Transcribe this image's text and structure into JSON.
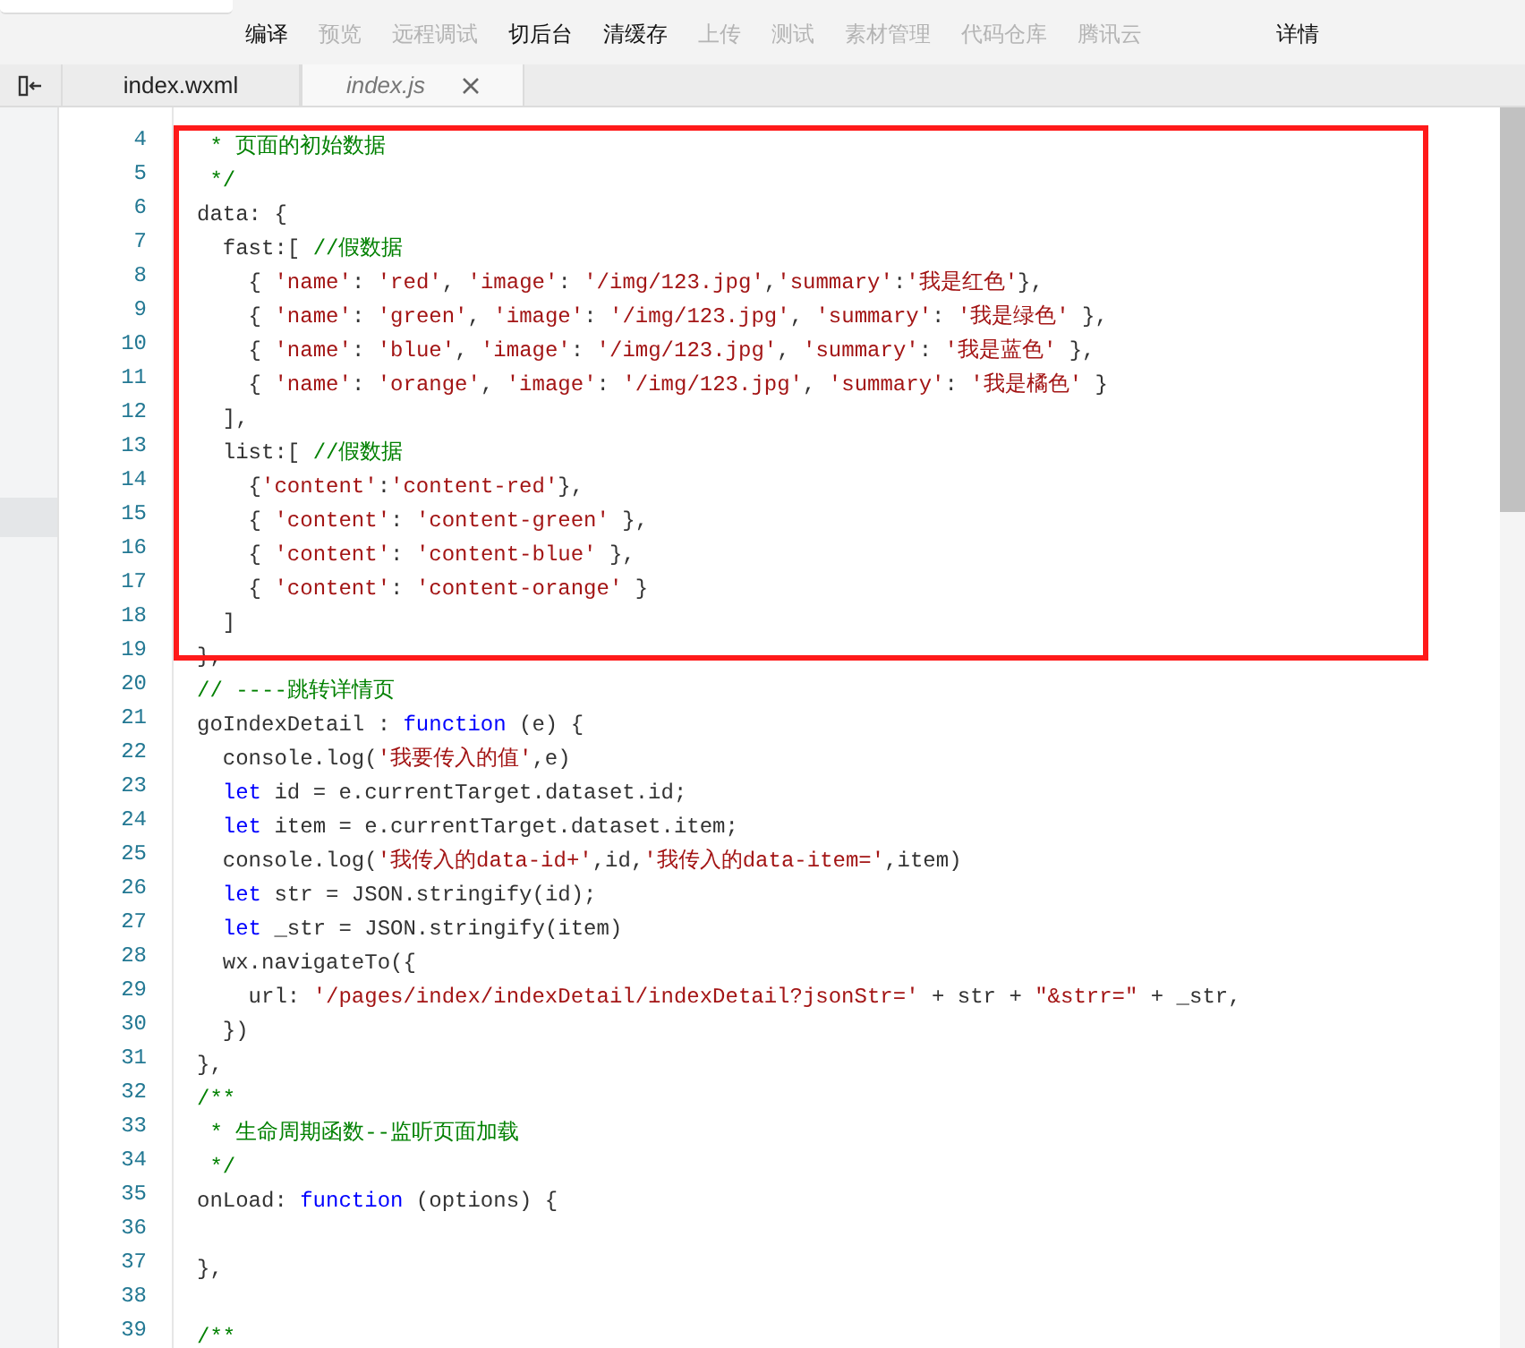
{
  "toolbar": {
    "buttons": [
      {
        "label": "编译",
        "disabled": false
      },
      {
        "label": "预览",
        "disabled": true
      },
      {
        "label": "远程调试",
        "disabled": true
      },
      {
        "label": "切后台",
        "disabled": false
      },
      {
        "label": "清缓存",
        "disabled": false
      },
      {
        "label": "上传",
        "disabled": true
      },
      {
        "label": "测试",
        "disabled": true
      },
      {
        "label": "素材管理",
        "disabled": true
      },
      {
        "label": "代码仓库",
        "disabled": true
      },
      {
        "label": "腾讯云",
        "disabled": true
      },
      {
        "label": "详情",
        "disabled": false
      }
    ]
  },
  "tabs": [
    {
      "label": "index.wxml",
      "selected": false,
      "closable": false
    },
    {
      "label": "index.js",
      "selected": true,
      "closable": true
    }
  ],
  "editor": {
    "lines": [
      {
        "number": "4",
        "tokens": [
          {
            "kind": "comment",
            "text": " * 页面的初始数据"
          }
        ]
      },
      {
        "number": "5",
        "tokens": [
          {
            "kind": "comment",
            "text": " */"
          }
        ]
      },
      {
        "number": "6",
        "tokens": [
          {
            "kind": "plain",
            "text": "data: {"
          }
        ]
      },
      {
        "number": "7",
        "tokens": [
          {
            "kind": "plain",
            "text": "  fast:[ "
          },
          {
            "kind": "comment",
            "text": "//假数据"
          }
        ]
      },
      {
        "number": "8",
        "tokens": [
          {
            "kind": "plain",
            "text": "    { "
          },
          {
            "kind": "string",
            "text": "'name'"
          },
          {
            "kind": "plain",
            "text": ": "
          },
          {
            "kind": "string",
            "text": "'red'"
          },
          {
            "kind": "plain",
            "text": ", "
          },
          {
            "kind": "string",
            "text": "'image'"
          },
          {
            "kind": "plain",
            "text": ": "
          },
          {
            "kind": "string",
            "text": "'/img/123.jpg'"
          },
          {
            "kind": "plain",
            "text": ","
          },
          {
            "kind": "string",
            "text": "'summary'"
          },
          {
            "kind": "plain",
            "text": ":"
          },
          {
            "kind": "string",
            "text": "'我是红色'"
          },
          {
            "kind": "plain",
            "text": "},"
          }
        ]
      },
      {
        "number": "9",
        "tokens": [
          {
            "kind": "plain",
            "text": "    { "
          },
          {
            "kind": "string",
            "text": "'name'"
          },
          {
            "kind": "plain",
            "text": ": "
          },
          {
            "kind": "string",
            "text": "'green'"
          },
          {
            "kind": "plain",
            "text": ", "
          },
          {
            "kind": "string",
            "text": "'image'"
          },
          {
            "kind": "plain",
            "text": ": "
          },
          {
            "kind": "string",
            "text": "'/img/123.jpg'"
          },
          {
            "kind": "plain",
            "text": ", "
          },
          {
            "kind": "string",
            "text": "'summary'"
          },
          {
            "kind": "plain",
            "text": ": "
          },
          {
            "kind": "string",
            "text": "'我是绿色'"
          },
          {
            "kind": "plain",
            "text": " },"
          }
        ]
      },
      {
        "number": "10",
        "tokens": [
          {
            "kind": "plain",
            "text": "    { "
          },
          {
            "kind": "string",
            "text": "'name'"
          },
          {
            "kind": "plain",
            "text": ": "
          },
          {
            "kind": "string",
            "text": "'blue'"
          },
          {
            "kind": "plain",
            "text": ", "
          },
          {
            "kind": "string",
            "text": "'image'"
          },
          {
            "kind": "plain",
            "text": ": "
          },
          {
            "kind": "string",
            "text": "'/img/123.jpg'"
          },
          {
            "kind": "plain",
            "text": ", "
          },
          {
            "kind": "string",
            "text": "'summary'"
          },
          {
            "kind": "plain",
            "text": ": "
          },
          {
            "kind": "string",
            "text": "'我是蓝色'"
          },
          {
            "kind": "plain",
            "text": " },"
          }
        ]
      },
      {
        "number": "11",
        "tokens": [
          {
            "kind": "plain",
            "text": "    { "
          },
          {
            "kind": "string",
            "text": "'name'"
          },
          {
            "kind": "plain",
            "text": ": "
          },
          {
            "kind": "string",
            "text": "'orange'"
          },
          {
            "kind": "plain",
            "text": ", "
          },
          {
            "kind": "string",
            "text": "'image'"
          },
          {
            "kind": "plain",
            "text": ": "
          },
          {
            "kind": "string",
            "text": "'/img/123.jpg'"
          },
          {
            "kind": "plain",
            "text": ", "
          },
          {
            "kind": "string",
            "text": "'summary'"
          },
          {
            "kind": "plain",
            "text": ": "
          },
          {
            "kind": "string",
            "text": "'我是橘色'"
          },
          {
            "kind": "plain",
            "text": " }"
          }
        ]
      },
      {
        "number": "12",
        "tokens": [
          {
            "kind": "plain",
            "text": "  ],"
          }
        ]
      },
      {
        "number": "13",
        "tokens": [
          {
            "kind": "plain",
            "text": "  list:[ "
          },
          {
            "kind": "comment",
            "text": "//假数据"
          }
        ]
      },
      {
        "number": "14",
        "tokens": [
          {
            "kind": "plain",
            "text": "    {"
          },
          {
            "kind": "string",
            "text": "'content'"
          },
          {
            "kind": "plain",
            "text": ":"
          },
          {
            "kind": "string",
            "text": "'content-red'"
          },
          {
            "kind": "plain",
            "text": "},"
          }
        ]
      },
      {
        "number": "15",
        "tokens": [
          {
            "kind": "plain",
            "text": "    { "
          },
          {
            "kind": "string",
            "text": "'content'"
          },
          {
            "kind": "plain",
            "text": ": "
          },
          {
            "kind": "string",
            "text": "'content-green'"
          },
          {
            "kind": "plain",
            "text": " },"
          }
        ]
      },
      {
        "number": "16",
        "tokens": [
          {
            "kind": "plain",
            "text": "    { "
          },
          {
            "kind": "string",
            "text": "'content'"
          },
          {
            "kind": "plain",
            "text": ": "
          },
          {
            "kind": "string",
            "text": "'content-blue'"
          },
          {
            "kind": "plain",
            "text": " },"
          }
        ]
      },
      {
        "number": "17",
        "tokens": [
          {
            "kind": "plain",
            "text": "    { "
          },
          {
            "kind": "string",
            "text": "'content'"
          },
          {
            "kind": "plain",
            "text": ": "
          },
          {
            "kind": "string",
            "text": "'content-orange'"
          },
          {
            "kind": "plain",
            "text": " }"
          }
        ]
      },
      {
        "number": "18",
        "tokens": [
          {
            "kind": "plain",
            "text": "  ]"
          }
        ]
      },
      {
        "number": "19",
        "tokens": [
          {
            "kind": "plain",
            "text": "},"
          }
        ]
      },
      {
        "number": "20",
        "tokens": [
          {
            "kind": "comment",
            "text": "// ----跳转详情页"
          }
        ]
      },
      {
        "number": "21",
        "tokens": [
          {
            "kind": "plain",
            "text": "goIndexDetail : "
          },
          {
            "kind": "keyword",
            "text": "function"
          },
          {
            "kind": "plain",
            "text": " (e) {"
          }
        ]
      },
      {
        "number": "22",
        "tokens": [
          {
            "kind": "plain",
            "text": "  console.log("
          },
          {
            "kind": "string",
            "text": "'我要传入的值'"
          },
          {
            "kind": "plain",
            "text": ",e)"
          }
        ]
      },
      {
        "number": "23",
        "tokens": [
          {
            "kind": "keyword",
            "text": "  let"
          },
          {
            "kind": "plain",
            "text": " id = e.currentTarget.dataset.id;"
          }
        ]
      },
      {
        "number": "24",
        "tokens": [
          {
            "kind": "keyword",
            "text": "  let"
          },
          {
            "kind": "plain",
            "text": " item = e.currentTarget.dataset.item;"
          }
        ]
      },
      {
        "number": "25",
        "tokens": [
          {
            "kind": "plain",
            "text": "  console.log("
          },
          {
            "kind": "string",
            "text": "'我传入的data-id+'"
          },
          {
            "kind": "plain",
            "text": ",id,"
          },
          {
            "kind": "string",
            "text": "'我传入的data-item='"
          },
          {
            "kind": "plain",
            "text": ",item)"
          }
        ]
      },
      {
        "number": "26",
        "tokens": [
          {
            "kind": "keyword",
            "text": "  let"
          },
          {
            "kind": "plain",
            "text": " str = JSON.stringify(id);"
          }
        ]
      },
      {
        "number": "27",
        "tokens": [
          {
            "kind": "keyword",
            "text": "  let"
          },
          {
            "kind": "plain",
            "text": " _str = JSON.stringify(item)"
          }
        ]
      },
      {
        "number": "28",
        "tokens": [
          {
            "kind": "plain",
            "text": "  wx.navigateTo({"
          }
        ]
      },
      {
        "number": "29",
        "tokens": [
          {
            "kind": "plain",
            "text": "    url: "
          },
          {
            "kind": "string",
            "text": "'/pages/index/indexDetail/indexDetail?jsonStr='"
          },
          {
            "kind": "plain",
            "text": " + str + "
          },
          {
            "kind": "string",
            "text": "\"&strr=\""
          },
          {
            "kind": "plain",
            "text": " + _str,"
          }
        ]
      },
      {
        "number": "30",
        "tokens": [
          {
            "kind": "plain",
            "text": "  })"
          }
        ]
      },
      {
        "number": "31",
        "tokens": [
          {
            "kind": "plain",
            "text": "},"
          }
        ]
      },
      {
        "number": "32",
        "tokens": [
          {
            "kind": "comment",
            "text": "/**"
          }
        ]
      },
      {
        "number": "33",
        "tokens": [
          {
            "kind": "comment",
            "text": " * 生命周期函数--监听页面加载"
          }
        ]
      },
      {
        "number": "34",
        "tokens": [
          {
            "kind": "comment",
            "text": " */"
          }
        ]
      },
      {
        "number": "35",
        "tokens": [
          {
            "kind": "plain",
            "text": "onLoad: "
          },
          {
            "kind": "keyword",
            "text": "function"
          },
          {
            "kind": "plain",
            "text": " (options) {"
          }
        ]
      },
      {
        "number": "36"
      },
      {
        "number": "37",
        "tokens": [
          {
            "kind": "plain",
            "text": "},"
          }
        ]
      },
      {
        "number": "38"
      },
      {
        "number": "39",
        "tokens": [
          {
            "kind": "comment",
            "text": "/**"
          }
        ]
      }
    ]
  }
}
